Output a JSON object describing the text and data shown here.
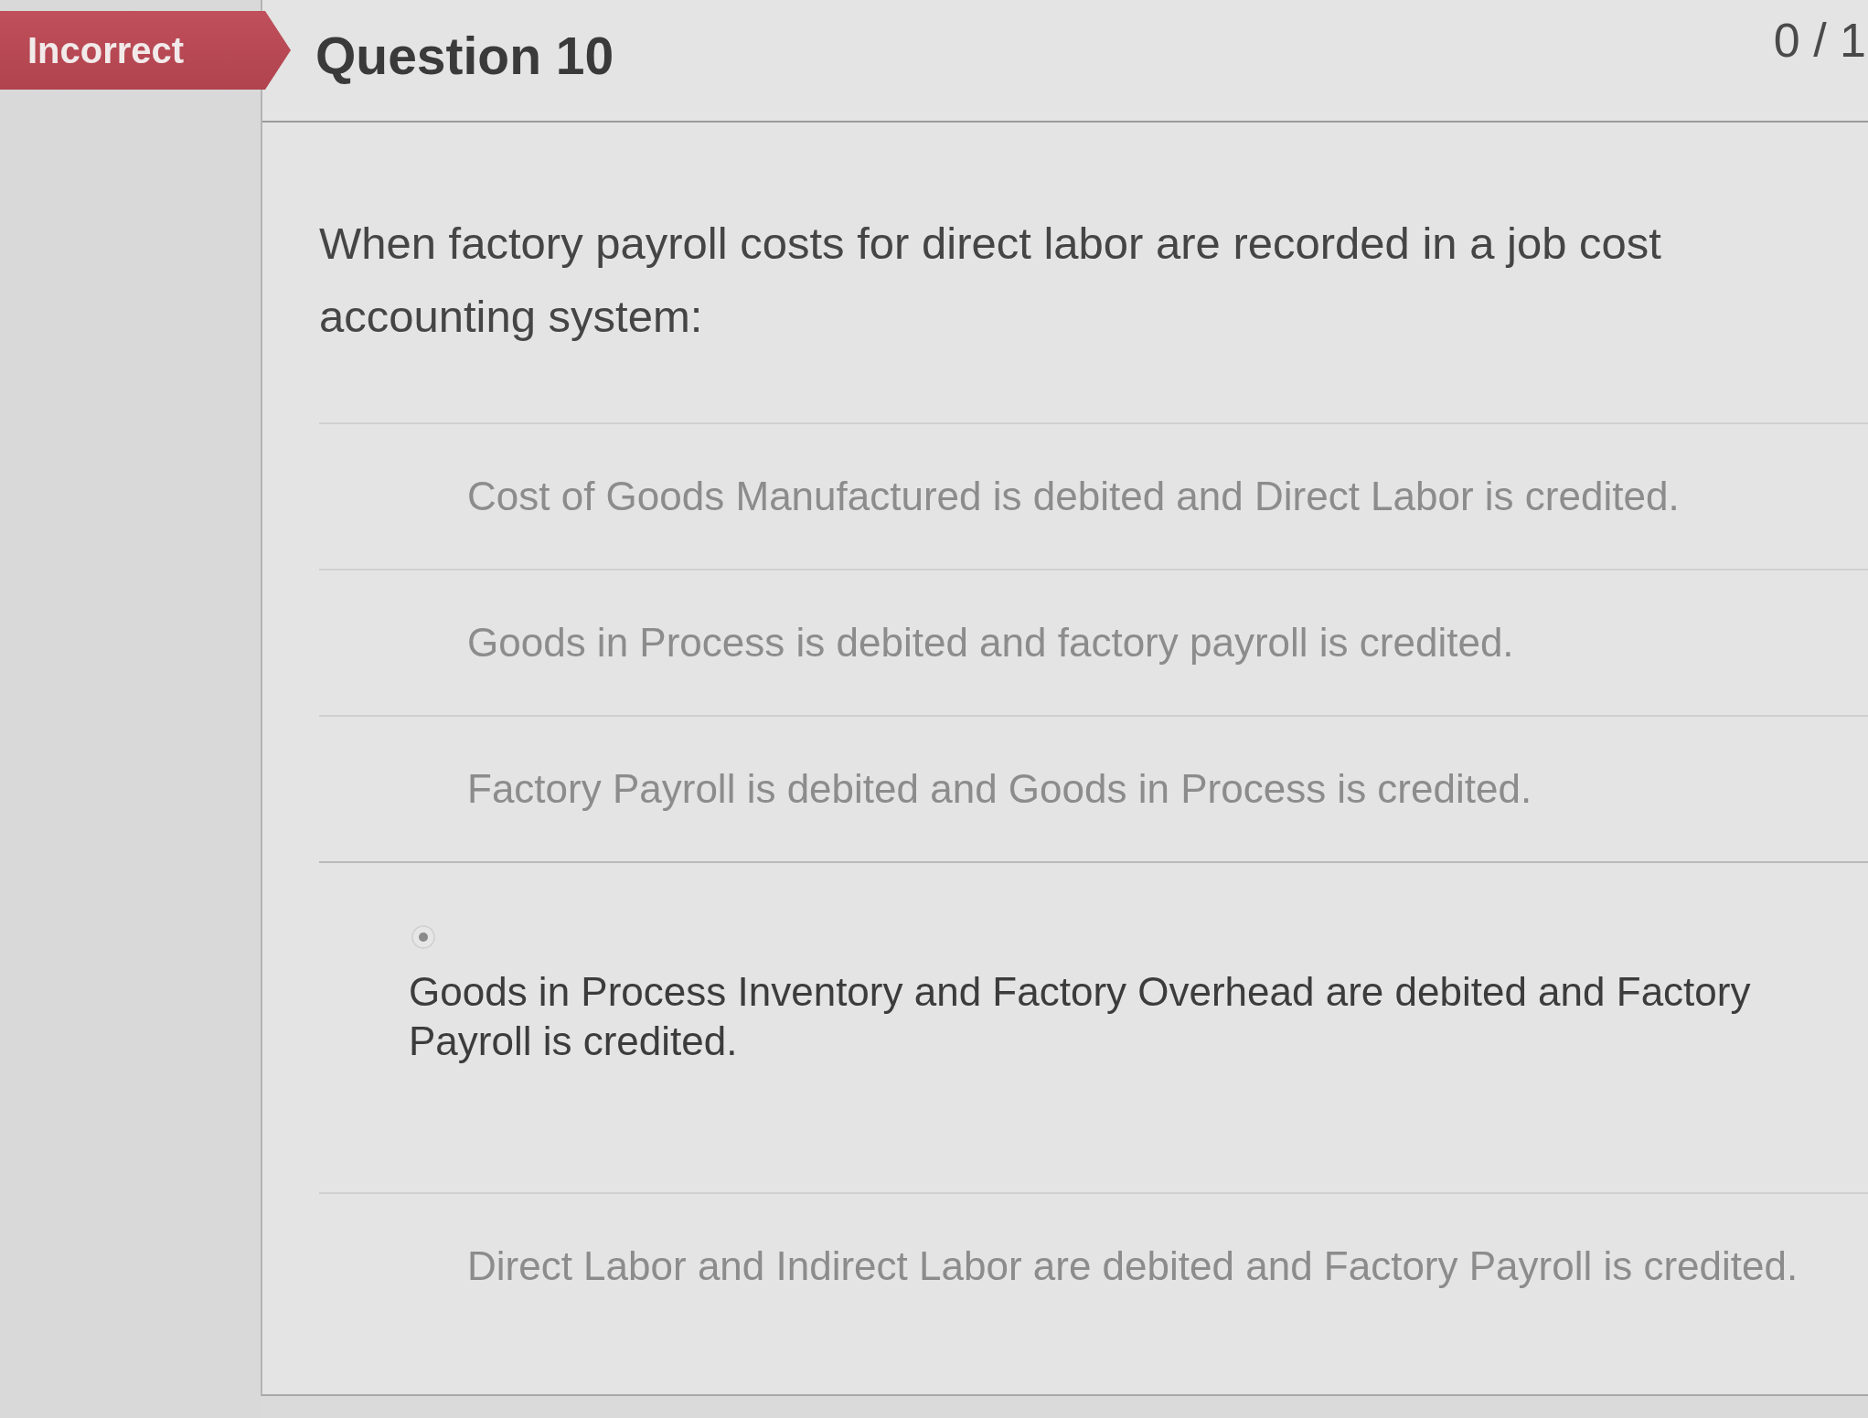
{
  "status_banner": {
    "label": "Incorrect"
  },
  "question": {
    "title": "Question 10",
    "score": "0 / 1",
    "prompt": "When factory payroll costs for direct labor are recorded in a job cost accounting system:",
    "answers": [
      {
        "text": "Cost of Goods Manufactured is debited and Direct Labor is credited.",
        "selected": false
      },
      {
        "text": "Goods in Process is debited and factory payroll is credited.",
        "selected": false
      },
      {
        "text": "Factory Payroll is debited and Goods in Process is credited.",
        "selected": false
      },
      {
        "text": "Goods in Process Inventory and Factory Overhead are debited and Factory Payroll is credited.",
        "selected": true
      },
      {
        "text": "Direct Labor and Indirect Labor are debited and Factory Payroll is credited.",
        "selected": false
      }
    ]
  }
}
